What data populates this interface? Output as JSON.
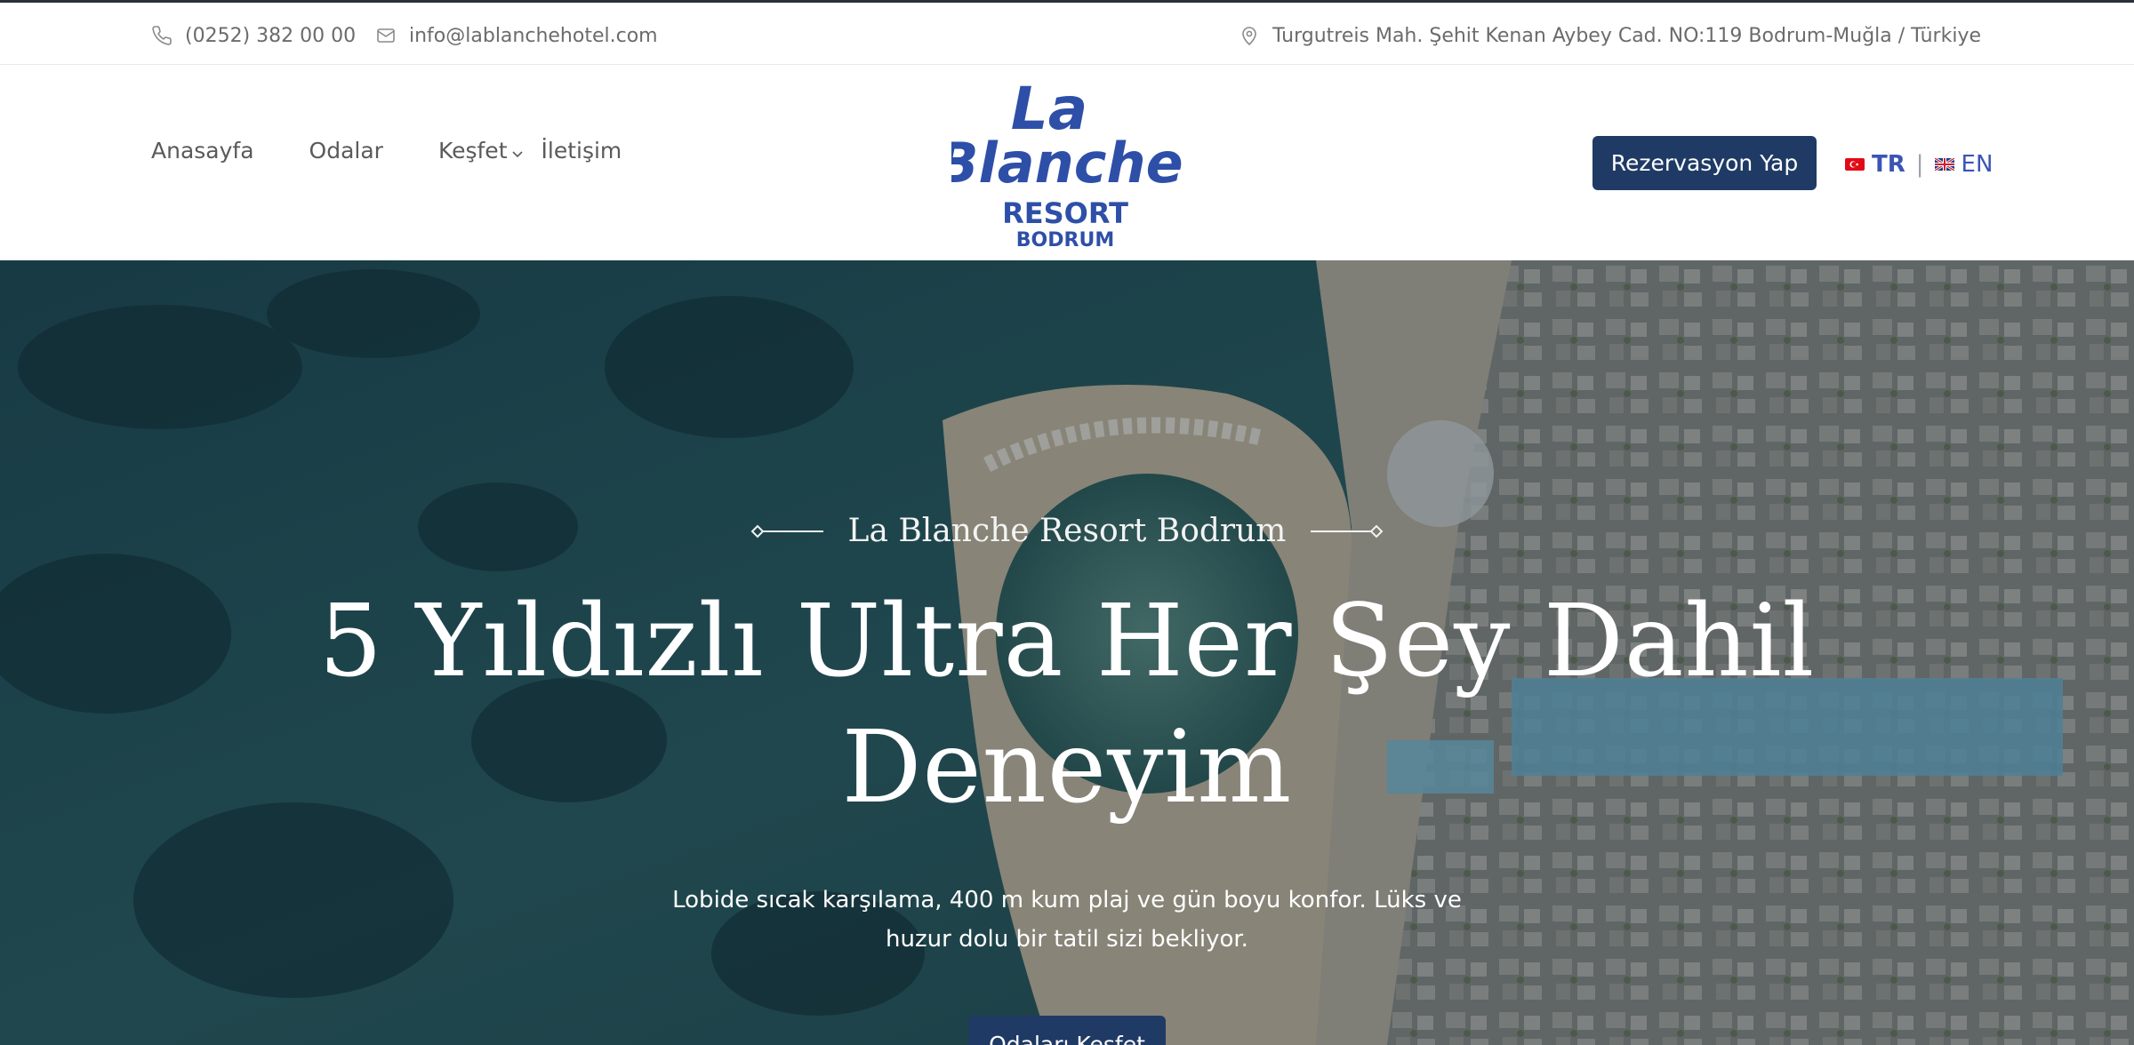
{
  "topbar": {
    "phone": "(0252) 382 00 00",
    "email": "info@lablanchehotel.com",
    "address": "Turgutreis Mah. Şehit Kenan Aybey Cad. NO:119 Bodrum-Muğla / Türkiye",
    "icons": [
      "phone-icon",
      "mail-icon",
      "location-pin-icon"
    ]
  },
  "nav": {
    "items": [
      {
        "label": "Anasayfa"
      },
      {
        "label": "Odalar"
      },
      {
        "label": "Keşfet",
        "has_dropdown": true
      },
      {
        "label": "İletişim"
      }
    ]
  },
  "logo": {
    "line1": "La",
    "line2": "Blanche",
    "line3": "RESORT",
    "line4": "BODRUM",
    "color": "#2e4fa8"
  },
  "header": {
    "cta_label": "Rezervasyon Yap",
    "lang_tr": "TR",
    "lang_sep": "|",
    "lang_en": "EN"
  },
  "hero": {
    "eyebrow": "La Blanche Resort Bodrum",
    "title": "5 Yıldızlı Ultra Her Şey Dahil Deneyim",
    "subtitle": "Lobide sıcak karşılama, 400 m kum plaj ve gün boyu konfor. Lüks ve huzur dolu bir tatil sizi bekliyor.",
    "button_label": "Odaları Keşfet"
  },
  "colors": {
    "primary": "#1f3a64",
    "accent": "#3a55b4",
    "text_muted": "#6b6b6b"
  }
}
